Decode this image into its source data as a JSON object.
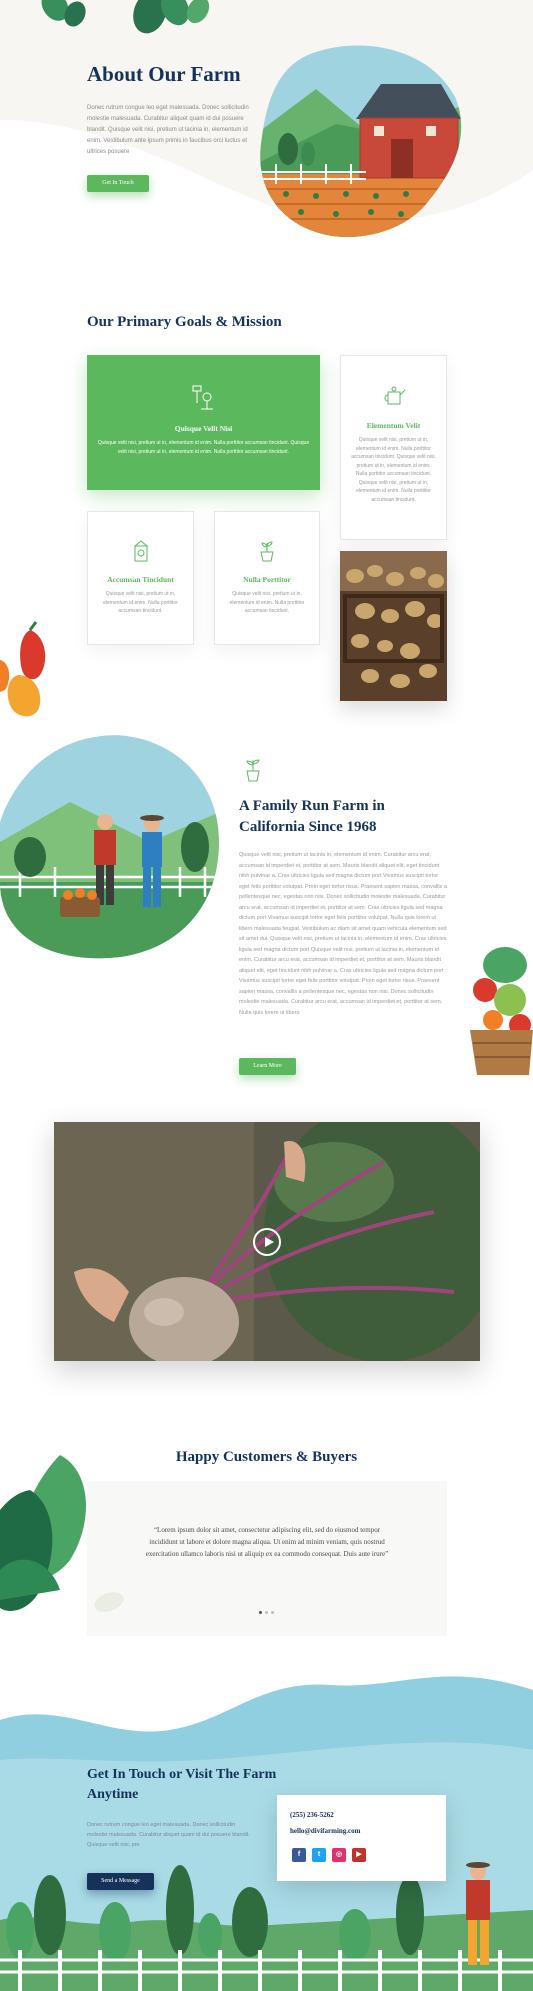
{
  "hero": {
    "title": "About Our Farm",
    "text": "Donec rutrum congue leo eget malesuada. Donec sollicitudin molestie malesuada. Curabitur aliquet quam id dui posuere blandit. Quisque velit nisi, pretium ut lacinia in, elementum id enim. Vestibulum ante ipsum primis in faucibus orci luctus et ultrices posuere",
    "button": "Get In Touch"
  },
  "goals": {
    "title": "Our Primary Goals & Mission",
    "cards": [
      {
        "title": "Quisque Velit Nisi",
        "text": "Quisque velit nisi, pretium ut in, elementum id enim. Nulla porttitor accumsan tincidunt. Quisque velit nisi, pretium ut in, elementum id enim. Nulla porttitor accumsan tincidunt."
      },
      {
        "title": "Elementum Velit",
        "text": "Quisque velit nisi, pretium ut in, elementum id enim. Nulla porttitor accumsan tincidunt. Quisque velit nisi, pretium ut in, elementum id enim. Nulla porttitor accumsan tincidunt. Quisque velit nisi, pretium ut in, elementum id enim. Nulla porttitor accumsan tincidunt."
      },
      {
        "title": "Accumsan Tincidunt",
        "text": "Quisque velit nisi, pretium ut in, elementum id enim. Nulla porttitor accumsan tincidunt."
      },
      {
        "title": "Nulla Porttitor",
        "text": "Quisque velit nisi, pretium ut in, elementum id enim. Nulla porttitor accumsan tincidunt."
      }
    ]
  },
  "family": {
    "title": "A Family Run Farm in California Since 1968",
    "text": "Quisque velit nisi, pretium ut lacinia in, elementum id enim. Curabitur arcu erat, accumsan id imperdiet et, porttitor at sem. Mauris blandit aliquet elit, eget tincidunt nibh pulvinar a. Cras ultricies ligula sed magna dictum port Vivamus suscipit tortor eget felis porttitor volutpat. Proin eget tortor risus. Praesent sapien massa, convallis a pellentesque nec, egestas non nisi. Donec sollicitudin molestie malesuada. Curabitur arcu erat, accumsan id imperdiet et, porttitor at sem. Cras ultricies ligula sed magna dictum port Vivamus suscipit tortor eget felis porttitor volutpat. Nulla quis lorem ut libero malesuada feugiat. Vestibulum ac diam sit amet quam vehicula elementum sed sit amet dui. Quisque velit nisi, pretium ut lacinia in, elementum id enim. Cras ultricies ligula sed magna dictum port Quisque velit nisi, pretium ut lacinia in, elementum id enim. Curabitur arcu erat, accumsan id imperdiet et, porttitor at sem. Mauris blandit aliquet elit, eget tincidunt nibh pulvinar a. Cras ultricies ligula sed magna dictum port Vivamus suscipit tortor eget felis porttitor volutpat. Proin eget tortor risus. Praesent sapien massa, convallis a pellentesque nec, egestas non nisi. Donec sollicitudin molestie malesuada. Curabitur arcu erat, accumsan id imperdiet et, porttitor at sem. Nulla quis lorem ut libero",
    "button": "Learn More"
  },
  "customers": {
    "title": "Happy Customers & Buyers",
    "quote": "“Lorem ipsum dolor sit amet, consectetur adipiscing elit, sed do eiusmod tempor incididunt ut labore et dolore magna aliqua. Ut enim ad minim veniam, quis nostrud exercitation ullamco laboris nisi ut aliquip ex ea commodo consequat. Duis aute irure”"
  },
  "contact": {
    "title": "Get In Touch or Visit The Farm Anytime",
    "text": "Donec rutrum congue leo eget malesuada. Donec sollicitudin molestie malesuada. Curabitur aliquet quam id dui posuere blandit. Quisque velit nisi, pre",
    "button": "Send a Message",
    "phone": "(255) 236-5262",
    "email": "hello@divifarming.com",
    "social": [
      {
        "icon": "facebook-icon",
        "glyph": "f",
        "color": "#3b5998"
      },
      {
        "icon": "twitter-icon",
        "glyph": "t",
        "color": "#1da1f2"
      },
      {
        "icon": "instagram-icon",
        "glyph": "◎",
        "color": "#e1306c"
      },
      {
        "icon": "youtube-icon",
        "glyph": "▶",
        "color": "#c4302b"
      }
    ]
  },
  "colors": {
    "green": "#5cb85c",
    "navy": "#15325b"
  }
}
